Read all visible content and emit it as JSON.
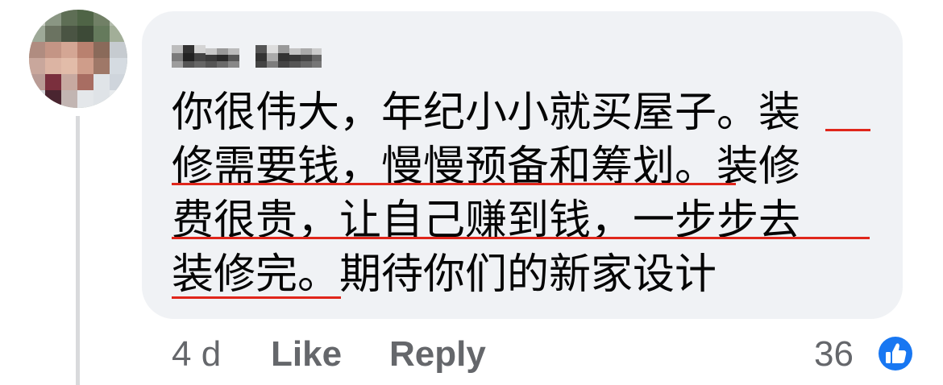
{
  "comment": {
    "text_lines": [
      "你很伟大，年纪小小就买屋子。装",
      "修需要钱，慢慢预备和筹划。装修",
      "费很贵，让自己赚到钱，一步步去",
      "装修完。期待你们的新家设计"
    ],
    "timestamp": "4 d",
    "like_label": "Like",
    "reply_label": "Reply",
    "reaction_count": "36",
    "reaction_icon": "thumbs-up-icon",
    "underline_color": "#e0261b",
    "badge_color": "#1877f2"
  }
}
